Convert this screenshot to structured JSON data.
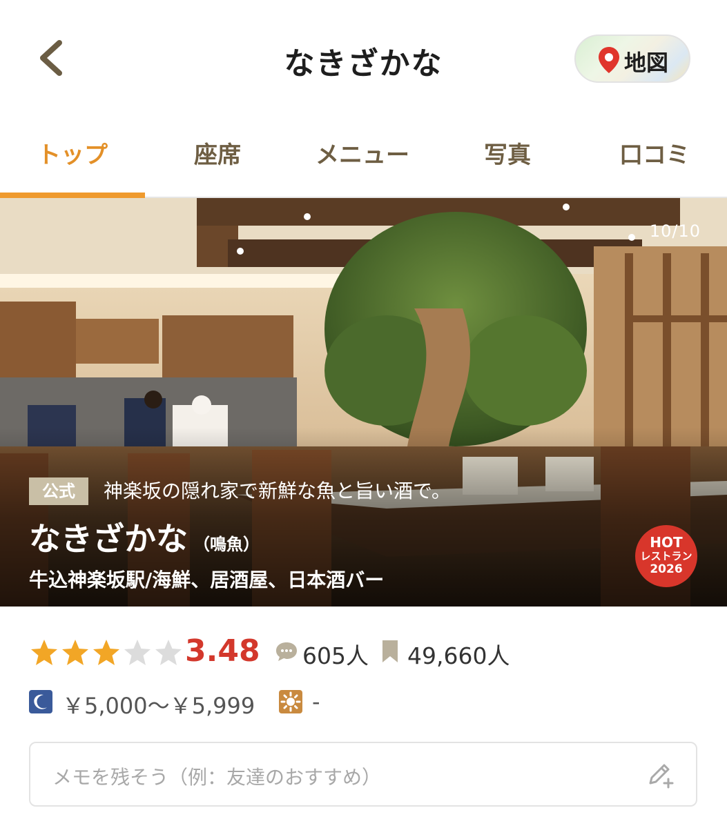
{
  "header": {
    "title": "なきざかな",
    "map_label": "地図"
  },
  "tabs": [
    {
      "label": "トップ",
      "active": true
    },
    {
      "label": "座席",
      "active": false
    },
    {
      "label": "メニュー",
      "active": false
    },
    {
      "label": "写真",
      "active": false
    },
    {
      "label": "口コミ",
      "active": false
    }
  ],
  "hero": {
    "counter": "10/10",
    "official_badge": "公式",
    "tagline": "神楽坂の隠れ家で新鮮な魚と旨い酒で。",
    "shop_name": "なきざかな",
    "shop_reading": "（鳴魚）",
    "meta": "牛込神楽坂駅/海鮮、居酒屋、日本酒バー",
    "hot_badge": {
      "line1": "HOT",
      "line2": "レストラン",
      "line3": "2026"
    }
  },
  "rating": {
    "stars_filled": 3,
    "stars_total": 5,
    "score": "3.48",
    "review_count": "605人",
    "bookmark_count": "49,660人"
  },
  "price": {
    "dinner_icon": "moon-icon",
    "dinner": "￥5,000～￥5,999",
    "lunch_icon": "sun-icon",
    "lunch": "-"
  },
  "memo": {
    "placeholder": "メモを残そう（例：友達のおすすめ）"
  },
  "colors": {
    "accent": "#ef9a2e",
    "score": "#d3382c",
    "star_filled": "#f2a626",
    "star_empty": "#dcdcdc",
    "tab_text": "#6e5e43",
    "badge": "#c9bfa6"
  }
}
